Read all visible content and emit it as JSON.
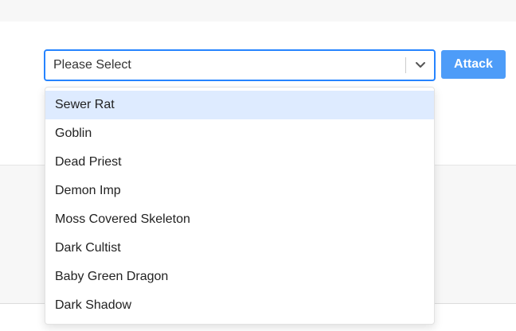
{
  "select": {
    "placeholder": "Please Select",
    "chevron_icon": "chevron-down-icon",
    "focus_color": "#2684ff"
  },
  "attack_button": {
    "label": "Attack",
    "color": "#4d9cf8"
  },
  "dropdown": {
    "highlight_color": "#deebff",
    "focused_index": 0,
    "options": [
      {
        "label": "Sewer Rat"
      },
      {
        "label": "Goblin"
      },
      {
        "label": "Dead Priest"
      },
      {
        "label": "Demon Imp"
      },
      {
        "label": "Moss Covered Skeleton"
      },
      {
        "label": "Dark Cultist"
      },
      {
        "label": "Baby Green Dragon"
      },
      {
        "label": "Dark Shadow"
      }
    ]
  }
}
